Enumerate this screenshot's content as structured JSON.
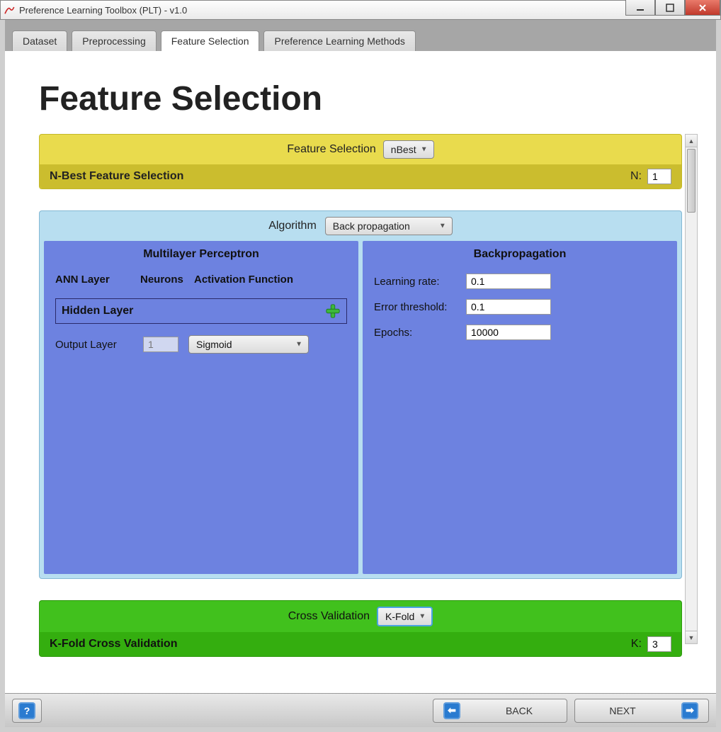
{
  "window": {
    "title": "Preference Learning Toolbox (PLT) - v1.0"
  },
  "tabs": [
    {
      "label": "Dataset"
    },
    {
      "label": "Preprocessing"
    },
    {
      "label": "Feature Selection"
    },
    {
      "label": "Preference Learning Methods"
    }
  ],
  "page": {
    "heading": "Feature Selection"
  },
  "featureSelection": {
    "label": "Feature Selection",
    "method": "nBest",
    "subtitle": "N-Best Feature Selection",
    "n_label": "N:",
    "n_value": "1"
  },
  "algorithm": {
    "label": "Algorithm",
    "selected": "Back propagation",
    "left": {
      "title": "Multilayer Perceptron",
      "col1": "ANN Layer",
      "col2": "Neurons",
      "col3": "Activation Function",
      "hidden_label": "Hidden Layer",
      "output_label": "Output Layer",
      "output_neurons": "1",
      "output_activation": "Sigmoid"
    },
    "right": {
      "title": "Backpropagation",
      "lr_label": "Learning rate:",
      "lr_value": "0.1",
      "err_label": "Error threshold:",
      "err_value": "0.1",
      "epochs_label": "Epochs:",
      "epochs_value": "10000"
    }
  },
  "crossValidation": {
    "label": "Cross Validation",
    "method": "K-Fold",
    "subtitle": "K-Fold Cross Validation",
    "k_label": "K:",
    "k_value": "3"
  },
  "nav": {
    "back": "BACK",
    "next": "NEXT"
  }
}
